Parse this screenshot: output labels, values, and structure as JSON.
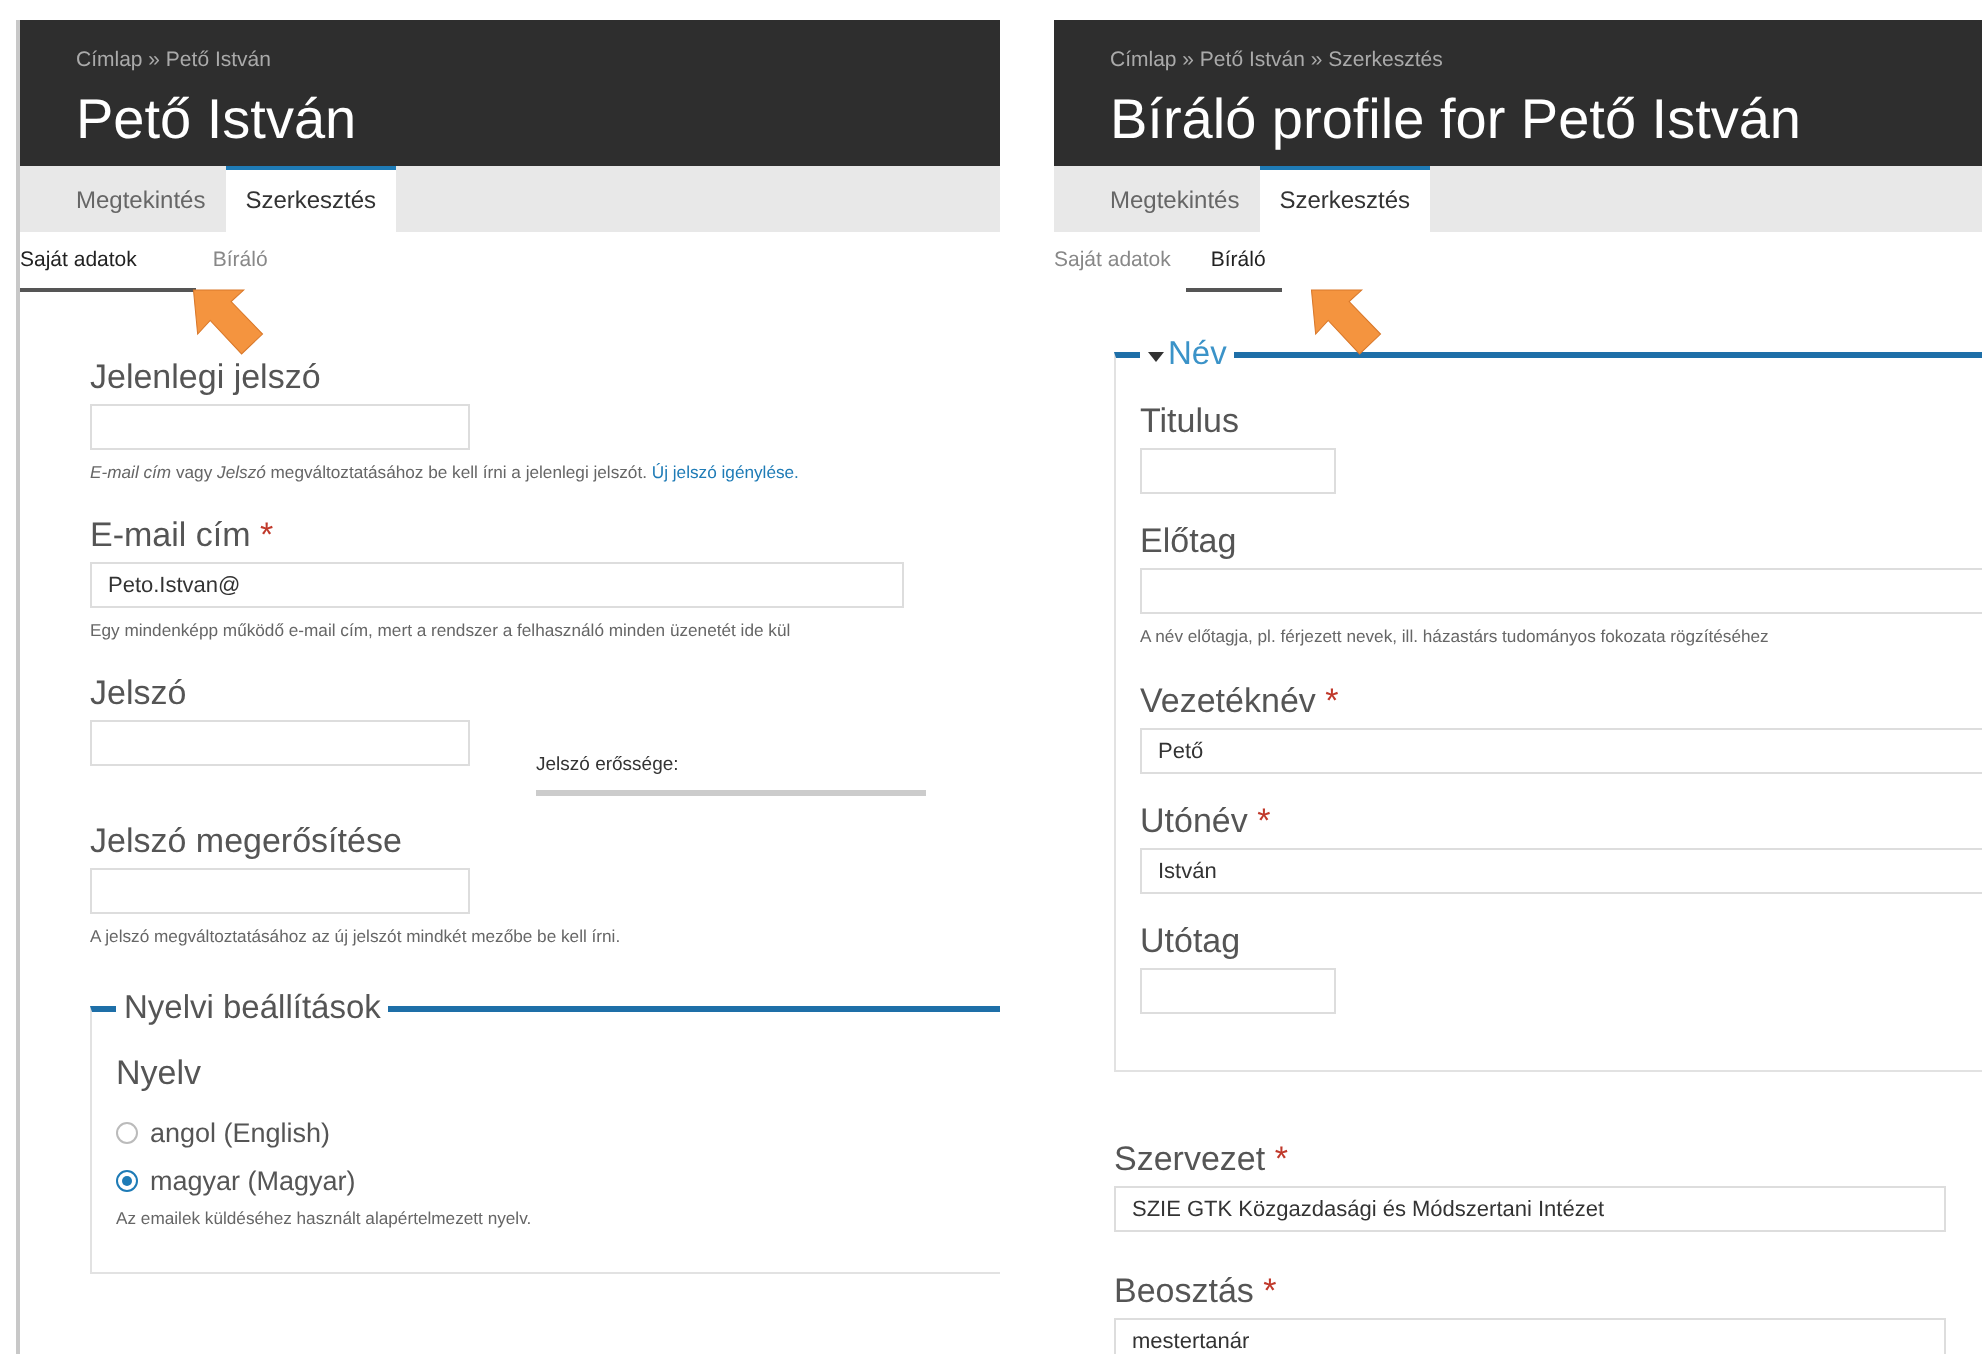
{
  "panels": [
    {
      "breadcrumb": "Címlap » Pető István",
      "title": "Pető István",
      "tabs": [
        {
          "label": "Megtekintés",
          "selected": false
        },
        {
          "label": "Szerkesztés",
          "selected": true
        }
      ],
      "subtabs": [
        {
          "label": "Saját adatok",
          "selected": true
        },
        {
          "label": "Bíráló",
          "selected": false
        }
      ],
      "items": [
        {
          "kind": "short-field",
          "label": "Jelenlegi jelszó"
        },
        {
          "kind": "help",
          "text": "*E-mail cím* vagy *Jelszó* megváltoztatásához be kell írni a jelenlegi jelszót.",
          "link": "Új jelszó igénylése."
        },
        {
          "kind": "field",
          "label": "E-mail cím",
          "mark": "*",
          "value": "Peto.Istvan@"
        },
        {
          "kind": "help",
          "text": "Egy mindenképp működő e-mail cím, mert a rendszer a felhasználó minden üzenetét ide kül"
        },
        {
          "kind": "password",
          "label": "Jelszó",
          "strength_label": "Jelszó erőssége:",
          "level": 0
        },
        {
          "kind": "short-field",
          "label": "Jelszó megerősítése"
        },
        {
          "kind": "help",
          "text": "A jelszó megváltoztatásához az új jelszót mindkét mezőbe be kell írni."
        },
        {
          "kind": "fieldset",
          "legend": "Nyelvi beállítások",
          "children": [
            {
              "kind": "radios",
              "label": "Nyelv",
              "options": [
                {
                  "label": "angol (English)",
                  "selected": false
                },
                {
                  "label": "magyar (Magyar)",
                  "selected": true
                }
              ]
            },
            {
              "kind": "help",
              "text": "Az emailek küldéséhez használt alapértelmezett nyelv."
            }
          ]
        }
      ]
    },
    {
      "breadcrumb": "Címlap » Pető István » Szerkesztés",
      "title": "Bíráló profile for Pető István",
      "tabs": [
        {
          "label": "Megtekintés",
          "selected": false
        },
        {
          "label": "Szerkesztés",
          "selected": true
        }
      ],
      "subtabs": [
        {
          "label": "Saját adatok",
          "selected": false
        },
        {
          "label": "Bíráló",
          "selected": true
        }
      ],
      "items": [
        {
          "kind": "fieldset",
          "legend": "Név",
          "expanded": true,
          "children": [
            {
              "kind": "tiny-field",
              "label": "Titulus"
            },
            {
              "kind": "field",
              "label": "Előtag"
            },
            {
              "kind": "help",
              "text": "A név előtagja, pl. férjezett nevek, ill. házastárs tudományos fokozata rögzítéséhez"
            },
            {
              "kind": "field",
              "label": "Vezetéknév",
              "mark": "*",
              "value": "Pető"
            },
            {
              "kind": "field",
              "label": "Utónév",
              "mark": "*",
              "value": "István"
            },
            {
              "kind": "tiny-field",
              "label": "Utótag"
            }
          ]
        },
        {
          "kind": "field",
          "label": "Szervezet",
          "mark": "*",
          "value": "SZIE GTK Közgazdasági és Módszertani Intézet"
        },
        {
          "kind": "field",
          "label": "Beosztás",
          "mark": "*",
          "value": "mestertanár"
        }
      ]
    }
  ]
}
